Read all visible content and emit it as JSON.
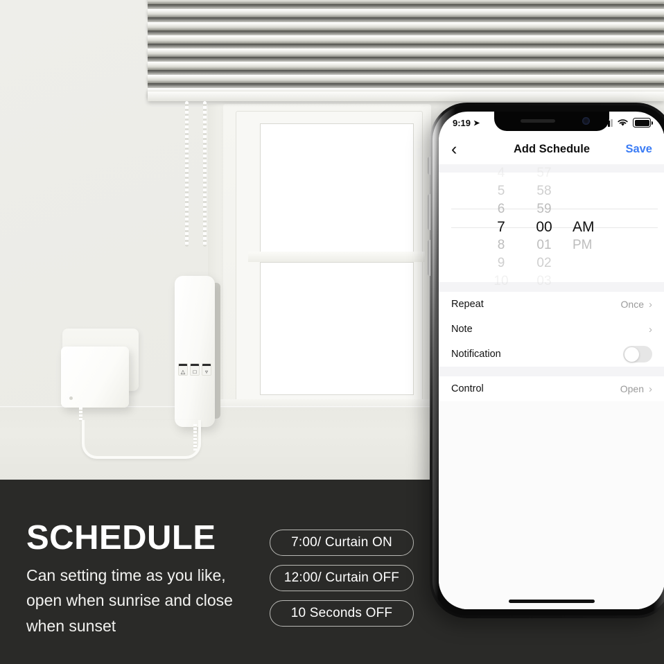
{
  "banner": {
    "headline": "SCHEDULE",
    "subcopy": "Can setting time as you like, open when sunrise and close when sunset",
    "pills": [
      {
        "label": "7:00/ Curtain ON"
      },
      {
        "label": "12:00/ Curtain OFF"
      },
      {
        "label": "10 Seconds OFF"
      }
    ],
    "background_color": "#2a2a28",
    "text_color": "#ffffff"
  },
  "phone": {
    "status_bar": {
      "time": "9:19",
      "location_icon": "location-arrow-icon",
      "signal_icon": "cellular-signal-icon",
      "wifi_icon": "wifi-icon",
      "battery_icon": "battery-full-icon"
    },
    "navbar": {
      "back_icon": "chevron-left-icon",
      "title": "Add Schedule",
      "save_label": "Save",
      "save_color": "#3b7cf5"
    },
    "time_picker": {
      "hours": [
        "4",
        "5",
        "6",
        "7",
        "8",
        "9",
        "10"
      ],
      "minutes": [
        "57",
        "58",
        "59",
        "00",
        "01",
        "02",
        "03"
      ],
      "meridiem": [
        "AM",
        "PM"
      ],
      "selected_hour": "7",
      "selected_minute": "00",
      "selected_meridiem": "AM"
    },
    "settings_rows": [
      {
        "label": "Repeat",
        "value": "Once",
        "accessory": "chevron-right-icon"
      },
      {
        "label": "Note",
        "value": "",
        "accessory": "chevron-right-icon"
      },
      {
        "label": "Notification",
        "value": "",
        "accessory": "toggle-off"
      }
    ],
    "control_rows": [
      {
        "label": "Control",
        "value": "Open",
        "accessory": "chevron-right-icon"
      }
    ],
    "home_indicator": "home-indicator"
  },
  "scene": {
    "wall_color": "#ecece8",
    "blind_slats": 9
  }
}
